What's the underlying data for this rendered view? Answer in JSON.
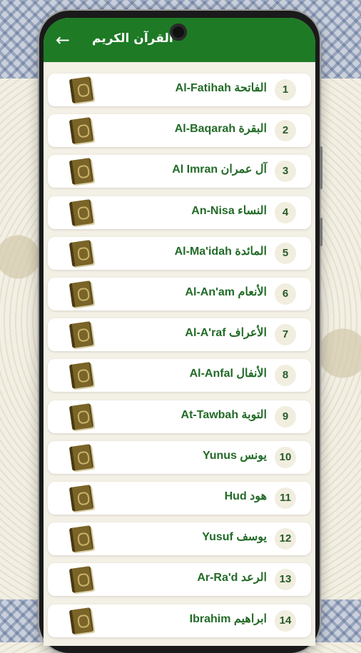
{
  "appbar": {
    "title": "القرآن الكريم",
    "back_icon": "arrow-left-icon",
    "color": "#1e7a25"
  },
  "surahs": [
    {
      "number": "1",
      "label": "Al-Fatihah  الفاتحة"
    },
    {
      "number": "2",
      "label": "Al-Baqarah البقرة"
    },
    {
      "number": "3",
      "label": "Al Imran آل عمران"
    },
    {
      "number": "4",
      "label": "An-Nisa  النساء"
    },
    {
      "number": "5",
      "label": "Al-Ma'idah المائدة"
    },
    {
      "number": "6",
      "label": "Al-An'am الأنعام"
    },
    {
      "number": "7",
      "label": "Al-A'raf الأعراف"
    },
    {
      "number": "8",
      "label": "Al-Anfal الأنفال"
    },
    {
      "number": "9",
      "label": "At-Tawbah التوبة"
    },
    {
      "number": "10",
      "label": "Yunus يونس"
    },
    {
      "number": "11",
      "label": "Hud هود"
    },
    {
      "number": "12",
      "label": "Yusuf يوسف"
    },
    {
      "number": "13",
      "label": "Ar-Ra'd الرعد"
    },
    {
      "number": "14",
      "label": "Ibrahim ابراهيم"
    }
  ],
  "icons": {
    "row_icon": "quran-book-icon"
  }
}
